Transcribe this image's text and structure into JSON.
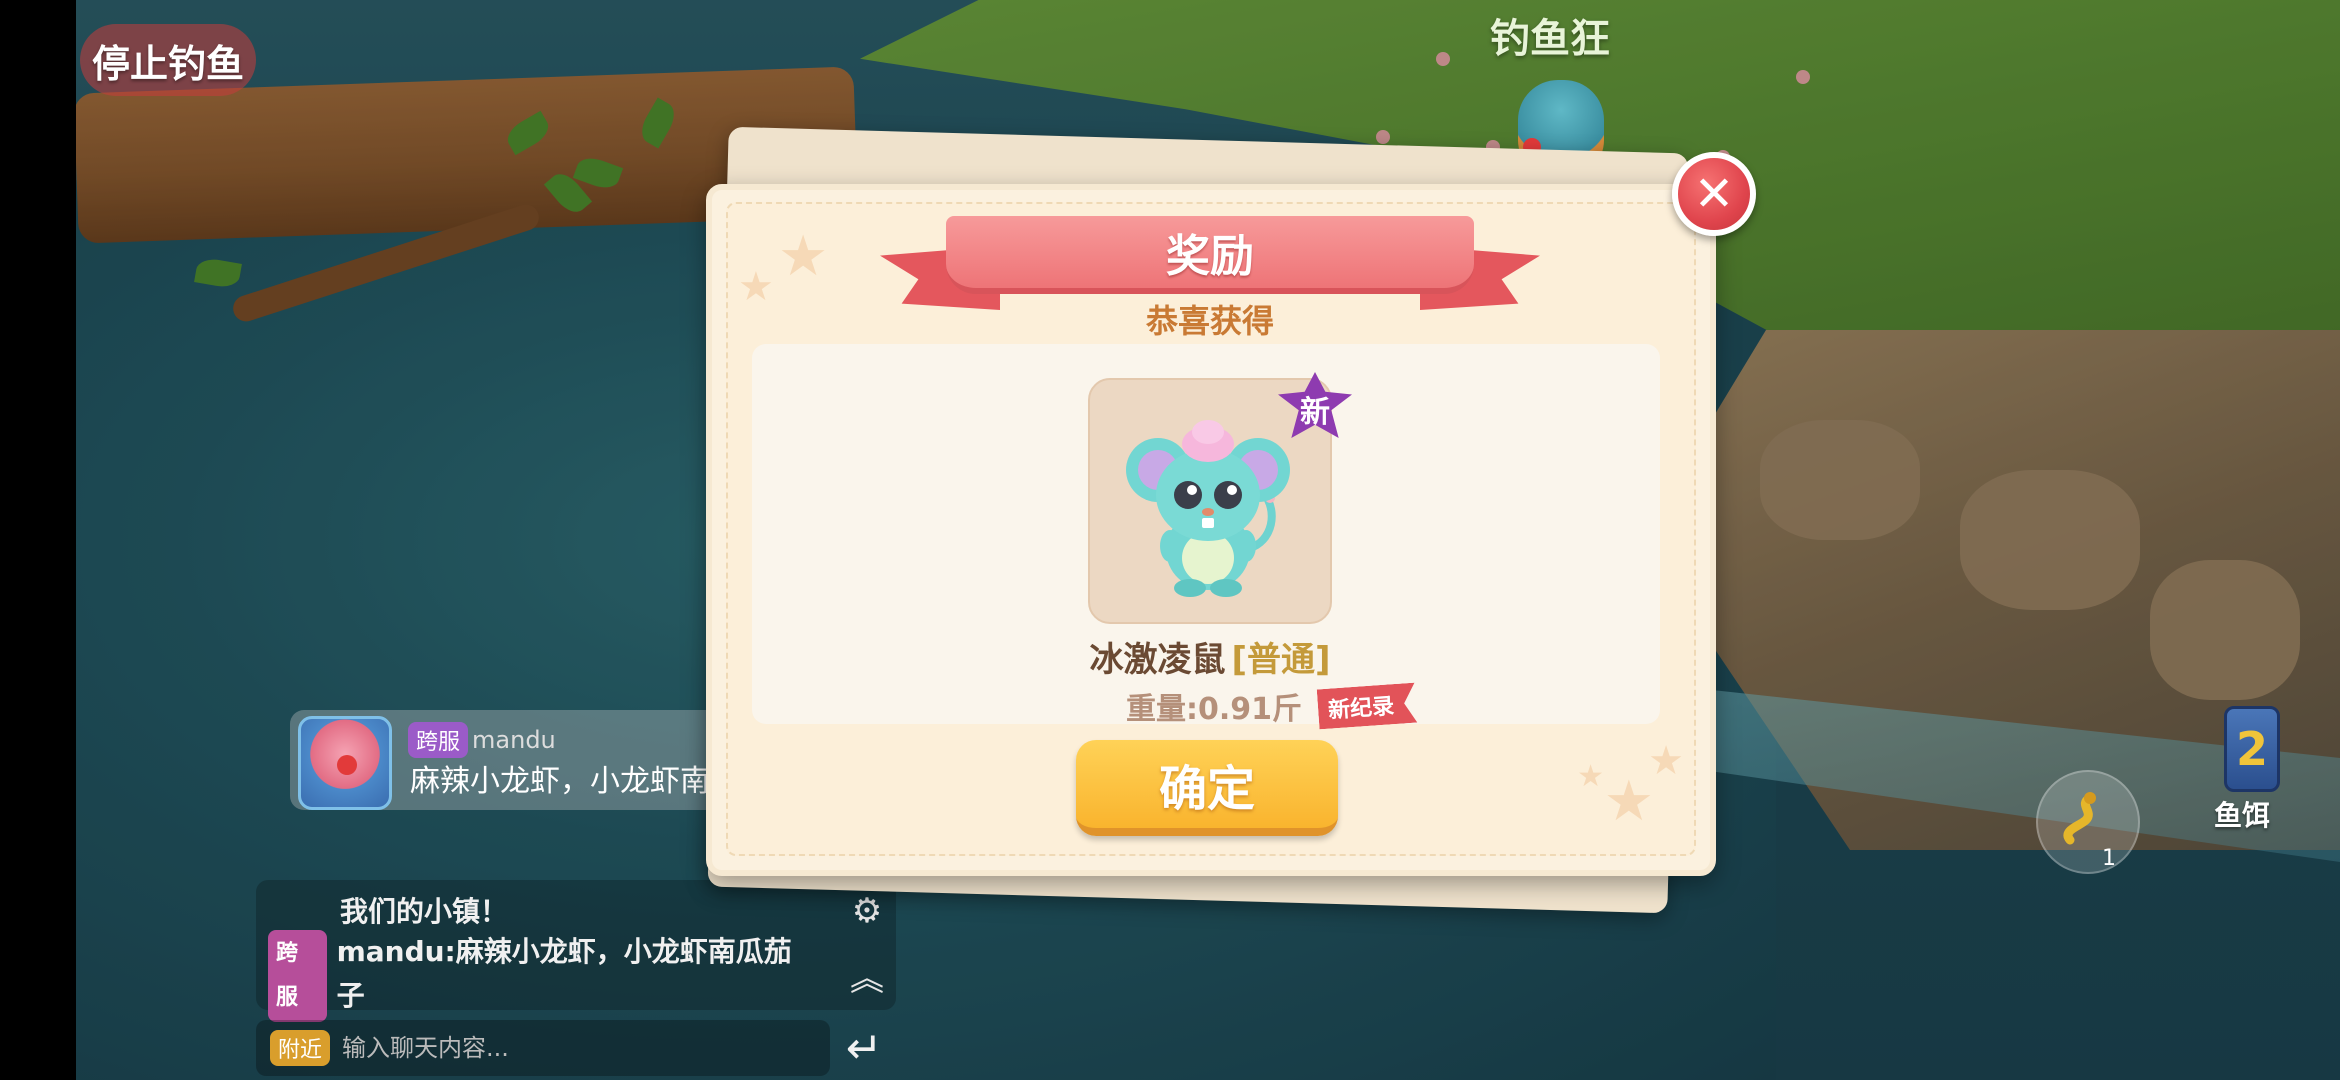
{
  "hud": {
    "stop_fishing_label": "停止钓鱼",
    "player_name": "钓鱼狂",
    "bait_label": "鱼饵",
    "bait_count": "1"
  },
  "chat": {
    "bubble": {
      "server_tag": "跨服",
      "username": "mandu",
      "message": "麻辣小龙虾，小龙虾南"
    },
    "panel": {
      "line1": "我们的小镇！",
      "line2_tag": "跨服",
      "line2_text": "mandu:麻辣小龙虾，小龙虾南瓜茄子"
    },
    "input": {
      "channel_tag": "附近",
      "placeholder": "输入聊天内容..."
    }
  },
  "reward": {
    "title": "奖励",
    "subtitle": "恭喜获得",
    "new_badge": "新",
    "item_name": "冰激凌鼠",
    "item_rarity": "[普通]",
    "weight": "重量:0.91斤",
    "record_tag": "新纪录",
    "confirm_label": "确定"
  },
  "colors": {
    "ribbon": "#ee7477",
    "confirm": "#f9b42e",
    "close": "#e0454d",
    "badge": "#8e3bb0"
  },
  "icons": [
    "close-icon",
    "gear-icon",
    "chevron-up-icon",
    "enter-icon",
    "worm-bait-icon",
    "bait-bag-icon"
  ]
}
